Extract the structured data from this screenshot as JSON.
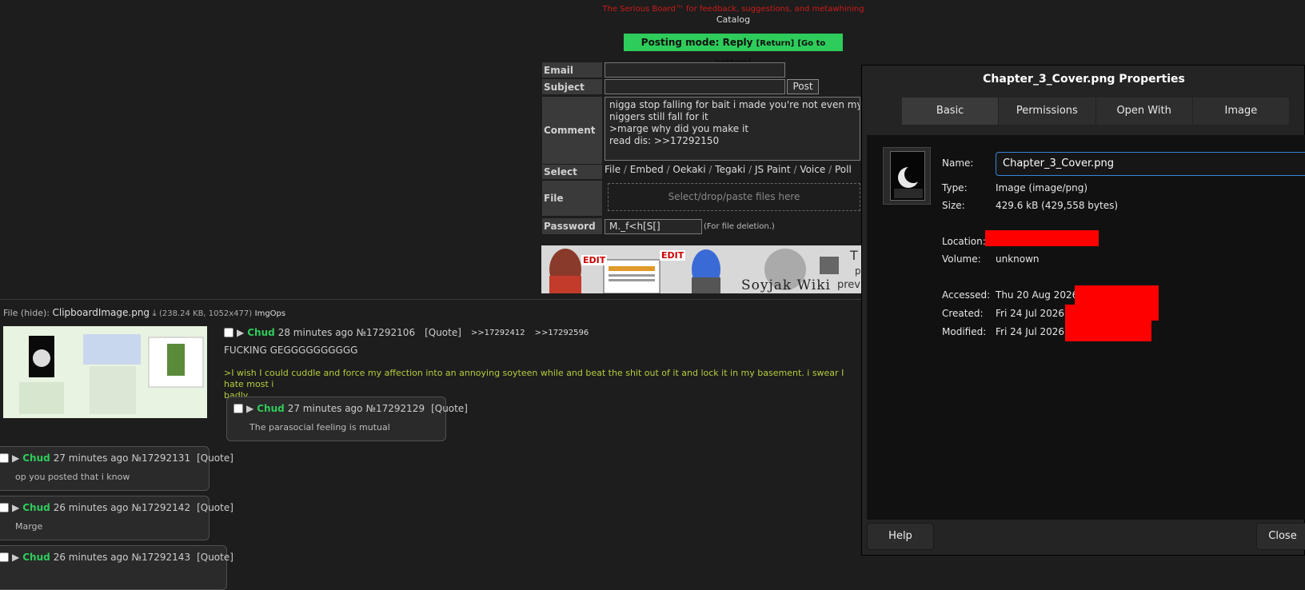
{
  "board": {
    "subtitle": "The Serious Board™ for feedback, suggestions, and metawhining",
    "catalog_link": "Catalog",
    "posting_mode": "Posting mode: Reply",
    "return_link": "[Return]",
    "bottom_link": "[Go to bottom]"
  },
  "form": {
    "email_label": "Email",
    "subject_label": "Subject",
    "comment_label": "Comment",
    "select_label": "Select",
    "file_label": "File",
    "password_label": "Password",
    "post_button": "Post",
    "comment_text": "nigga stop falling for bait i made you're not even my ta\nniggers still fall for it\n>marge why did you make it\nread dis: >>17292150",
    "select_options": [
      "File",
      "Embed",
      "Oekaki",
      "Tegaki",
      "JS Paint",
      "Voice",
      "Poll"
    ],
    "file_drop_text": "Select/drop/paste files here",
    "password_value": "M._f<h[S[]",
    "password_note": "(For file deletion.)"
  },
  "banner": {
    "edit_text": "EDIT",
    "wiki_text": "Soyjak Wiki",
    "side_t": "T",
    "side_p": "p",
    "side_prev": "prev"
  },
  "thread": {
    "file_prefix": "File",
    "file_hide": "(hide):",
    "file_name": "ClipboardImage.png",
    "file_meta": "(238.24 KB, 1052x477)",
    "file_ops": "ImgOps",
    "op": {
      "name": "Chud",
      "time": "28 minutes ago",
      "number": "№17292106",
      "quote": "[Quote]",
      "backlinks": [
        ">>17292412",
        ">>17292596"
      ],
      "line1": "FUCKING GEGGGGGGGGGG",
      "line2": ">I wish I could cuddle and force my affection into an annoying soyteen while and beat the shit out of it and lock it in my basement. i swear I hate most i",
      "line3": "badly."
    },
    "replies": [
      {
        "name": "Chud",
        "time": "27 minutes ago",
        "number": "№17292129",
        "quote": "[Quote]",
        "body": "The parasocial feeling is mutual"
      },
      {
        "name": "Chud",
        "time": "27 minutes ago",
        "number": "№17292131",
        "quote": "[Quote]",
        "body": "op you posted that i know"
      },
      {
        "name": "Chud",
        "time": "26 minutes ago",
        "number": "№17292142",
        "quote": "[Quote]",
        "body": "Marge"
      },
      {
        "name": "Chud",
        "time": "26 minutes ago",
        "number": "№17292143",
        "quote": "[Quote]",
        "body": ""
      }
    ]
  },
  "dialog": {
    "title": "Chapter_3_Cover.png Properties",
    "tabs": [
      "Basic",
      "Permissions",
      "Open With",
      "Image"
    ],
    "active_tab": "Basic",
    "labels": {
      "name": "Name:",
      "type": "Type:",
      "size": "Size:",
      "location": "Location:",
      "volume": "Volume:",
      "accessed": "Accessed:",
      "created": "Created:",
      "modified": "Modified:"
    },
    "values": {
      "name": "Chapter_3_Cover.png",
      "type": "Image (image/png)",
      "size": "429.6 kB (429,558 bytes)",
      "volume": "unknown",
      "accessed": "Thu 20 Aug 2026",
      "created": "Fri 24 Jul 2026",
      "modified": "Fri 24 Jul 2026"
    },
    "help_button": "Help",
    "close_button": "Close"
  },
  "colors": {
    "accent_green": "#2ecc5a",
    "subtitle_red": "#cc1b1b",
    "greentext": "#b5cc3e",
    "redaction": "#ff0000",
    "focus_blue": "#3b84d6"
  }
}
